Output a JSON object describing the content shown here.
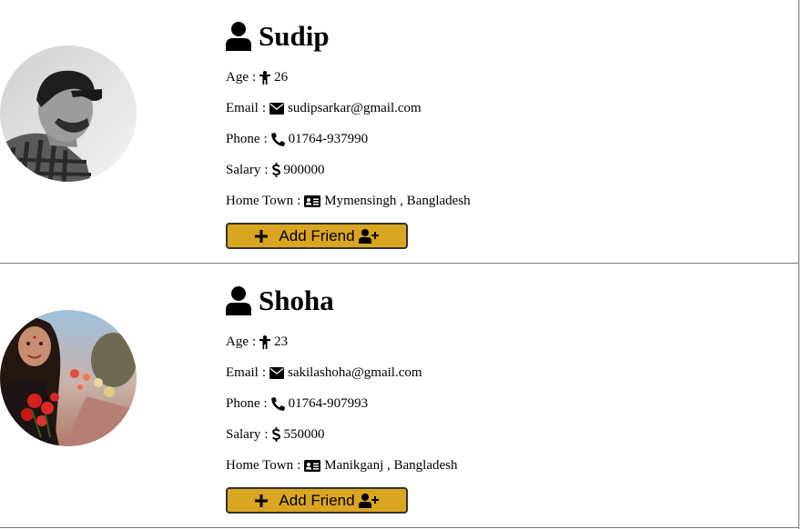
{
  "colors": {
    "button_bg": "#daa520",
    "divider": "#777777"
  },
  "profiles": [
    {
      "name": "Sudip",
      "age_label": "Age",
      "age": "26",
      "email_label": "Email",
      "email": "sudipsarkar@gmail.com",
      "phone_label": "Phone",
      "phone": "01764-937990",
      "salary_label": "Salary",
      "salary": "900000",
      "hometown_label": "Home Town",
      "hometown": "Mymensingh , Bangladesh",
      "button_label": "Add Friend",
      "icons": [
        "user-icon",
        "child-icon",
        "envelope-icon",
        "phone-icon",
        "dollar-icon",
        "id-card-icon",
        "plus-icon",
        "user-plus-icon"
      ]
    },
    {
      "name": "Shoha",
      "age_label": "Age",
      "age": "23",
      "email_label": "Email",
      "email": "sakilashoha@gmail.com",
      "phone_label": "Phone",
      "phone": "01764-907993",
      "salary_label": "Salary",
      "salary": "550000",
      "hometown_label": "Home Town",
      "hometown": "Manikganj , Bangladesh",
      "button_label": "Add Friend",
      "icons": [
        "user-icon",
        "child-icon",
        "envelope-icon",
        "phone-icon",
        "dollar-icon",
        "id-card-icon",
        "plus-icon",
        "user-plus-icon"
      ]
    }
  ]
}
